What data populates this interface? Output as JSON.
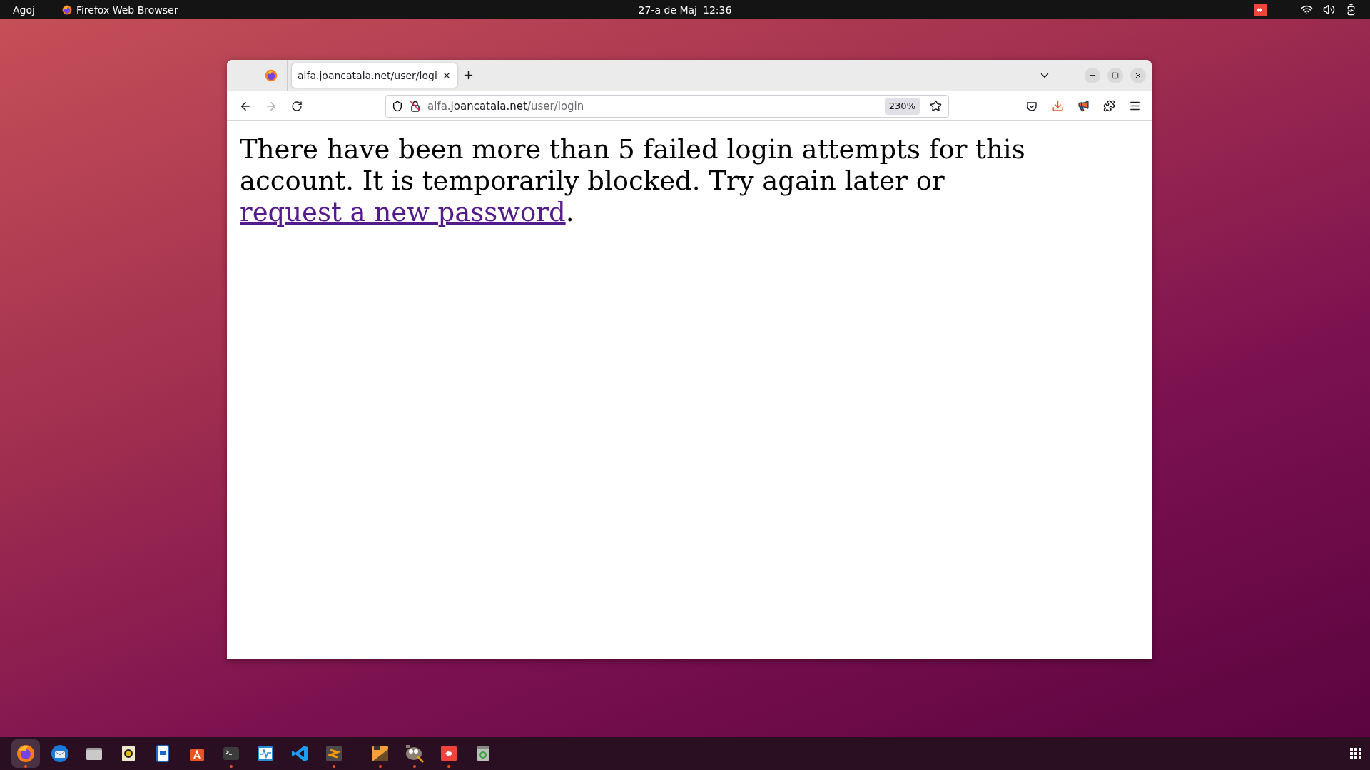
{
  "top_bar": {
    "activities": "Agoj",
    "app_name": "Firefox Web Browser",
    "date": "27-a de Maj",
    "time": "12:36"
  },
  "browser": {
    "tabs": [
      {
        "title": "alfa.joancatala.net/user/logi",
        "selected": true
      }
    ],
    "nav": {
      "back_disabled": false,
      "forward_disabled": true
    },
    "address": {
      "prefix": "alfa.",
      "domain": "joancatala.net",
      "path": "/user/login"
    },
    "zoom": "230%",
    "message": {
      "text": "There have been more than 5 failed login attempts for this account. It is temporarily blocked. Try again later or",
      "link": "request a new password",
      "after": "."
    }
  },
  "taskbar": {
    "apps": [
      {
        "selected": true,
        "running": true
      },
      {
        "selected": false,
        "running": false
      },
      {
        "selected": false,
        "running": false
      },
      {
        "selected": false,
        "running": false
      },
      {
        "selected": false,
        "running": false
      },
      {
        "selected": false,
        "running": false
      },
      {
        "selected": false,
        "running": true
      },
      {
        "selected": false,
        "running": false
      },
      {
        "selected": false,
        "running": false
      },
      {
        "selected": false,
        "running": true
      },
      {
        "selected": false,
        "running": true
      },
      {
        "selected": false,
        "running": true
      },
      {
        "selected": false,
        "running": true
      },
      {
        "selected": false,
        "running": false
      }
    ]
  }
}
